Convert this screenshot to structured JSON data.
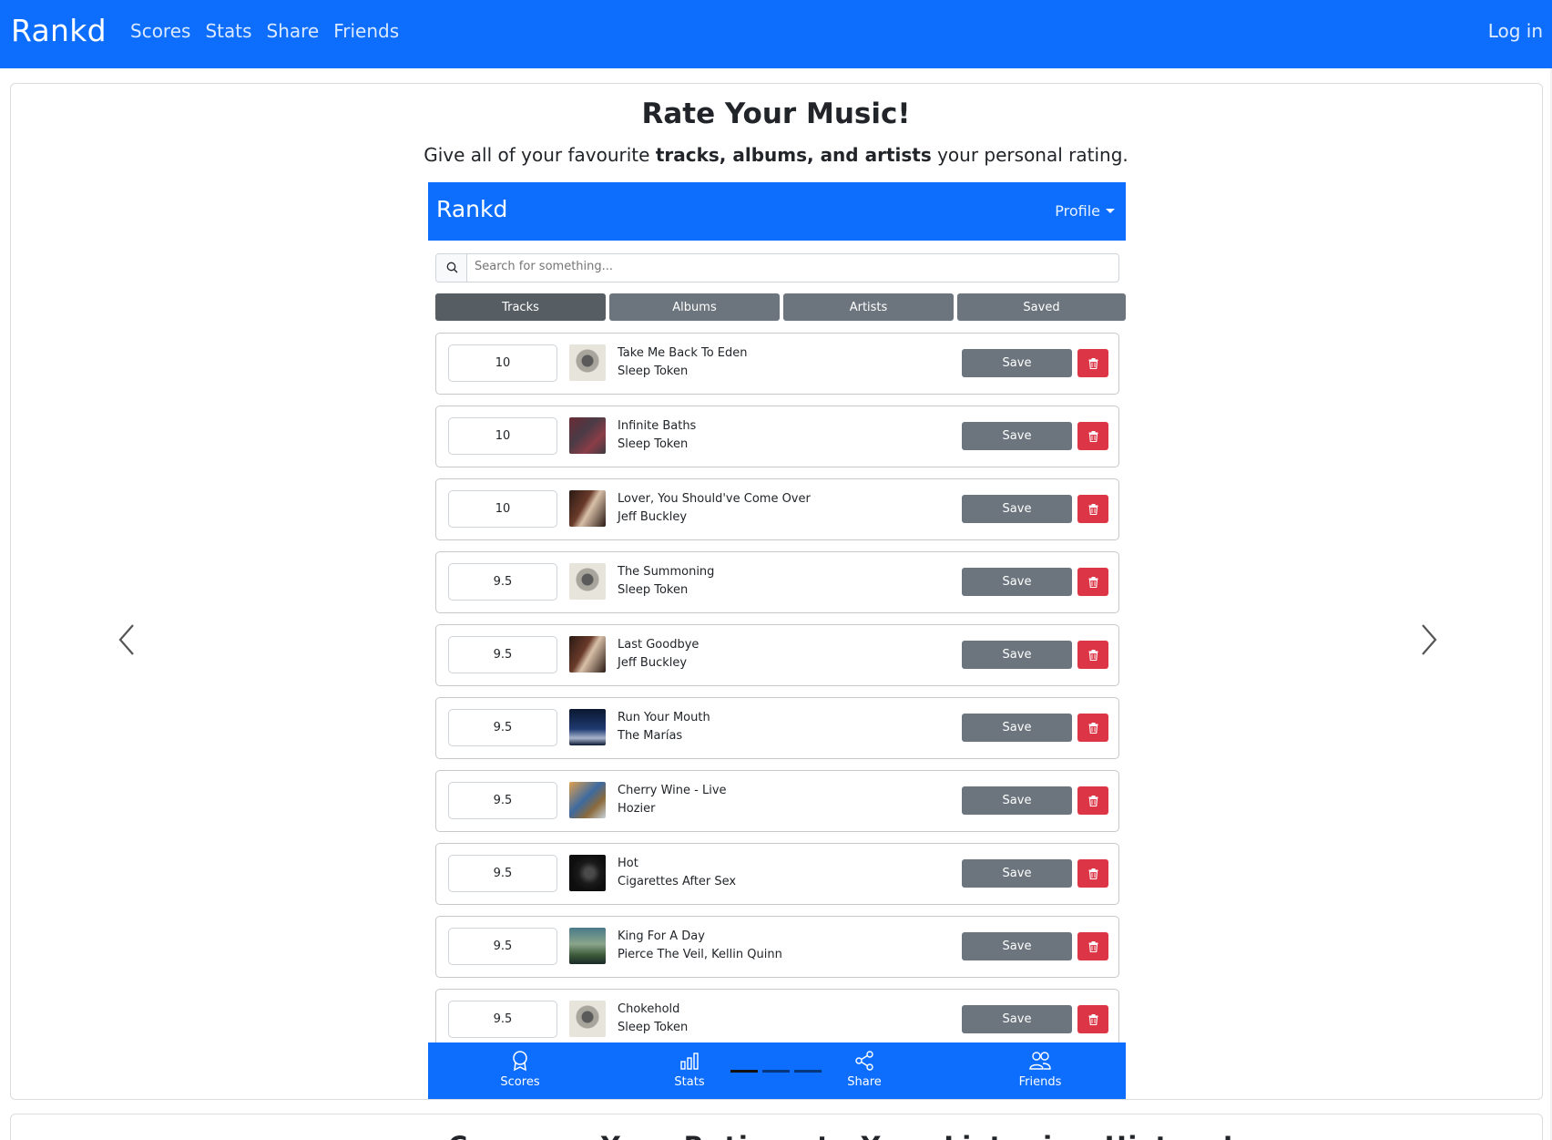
{
  "navbar": {
    "brand": "Rankd",
    "links": [
      "Scores",
      "Stats",
      "Share",
      "Friends"
    ],
    "login": "Log in"
  },
  "hero": {
    "title": "Rate Your Music!",
    "subtitle_pre": "Give all of your favourite ",
    "subtitle_bold": "tracks, albums, and artists",
    "subtitle_post": " your personal rating."
  },
  "phone": {
    "brand": "Rankd",
    "profile": "Profile",
    "search_placeholder": "Search for something...",
    "tabs": [
      "Tracks",
      "Albums",
      "Artists",
      "Saved"
    ],
    "active_tab": "Tracks",
    "save_label": "Save",
    "tracks": [
      {
        "score": "10",
        "title": "Take Me Back To Eden",
        "artist": "Sleep Token",
        "art": "art-st"
      },
      {
        "score": "10",
        "title": "Infinite Baths",
        "artist": "Sleep Token",
        "art": "art-ib"
      },
      {
        "score": "10",
        "title": "Lover, You Should've Come Over",
        "artist": "Jeff Buckley",
        "art": "art-jb"
      },
      {
        "score": "9.5",
        "title": "The Summoning",
        "artist": "Sleep Token",
        "art": "art-st"
      },
      {
        "score": "9.5",
        "title": "Last Goodbye",
        "artist": "Jeff Buckley",
        "art": "art-jb"
      },
      {
        "score": "9.5",
        "title": "Run Your Mouth",
        "artist": "The Marías",
        "art": "art-tm"
      },
      {
        "score": "9.5",
        "title": "Cherry Wine - Live",
        "artist": "Hozier",
        "art": "art-hz"
      },
      {
        "score": "9.5",
        "title": "Hot",
        "artist": "Cigarettes After Sex",
        "art": "art-cas"
      },
      {
        "score": "9.5",
        "title": "King For A Day",
        "artist": "Pierce The Veil, Kellin Quinn",
        "art": "art-ptv"
      },
      {
        "score": "9.5",
        "title": "Chokehold",
        "artist": "Sleep Token",
        "art": "art-st"
      }
    ],
    "bottom_nav": [
      "Scores",
      "Stats",
      "Share",
      "Friends"
    ]
  },
  "section2": {
    "title": "Compare Your Ratings to Your Listening History!"
  },
  "colors": {
    "primary": "#0d6efd",
    "secondary": "#6c757d",
    "danger": "#dc3545"
  }
}
